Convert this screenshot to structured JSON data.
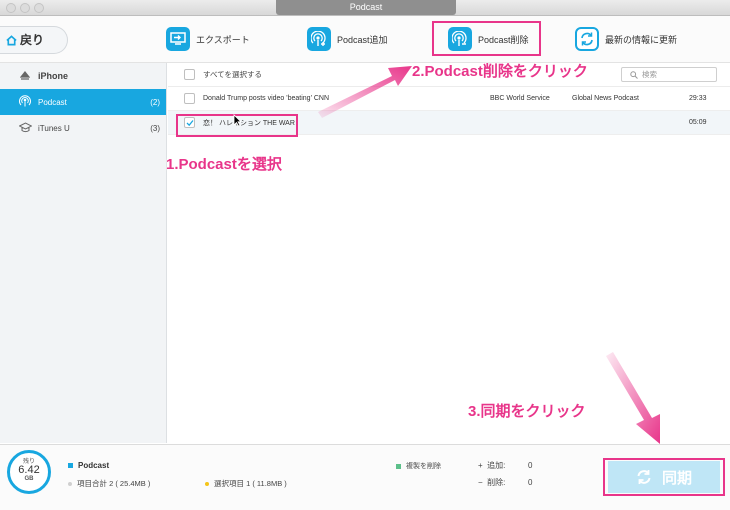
{
  "window": {
    "title": "Podcast"
  },
  "toolbar": {
    "back_label": "戻り",
    "export_label": "エクスポート",
    "add_label": "Podcast追加",
    "delete_label": "Podcast削除",
    "refresh_label": "最新の情報に更新"
  },
  "sidebar": {
    "device": "iPhone",
    "items": [
      {
        "label": "Podcast",
        "count": "(2)"
      },
      {
        "label": "iTunes U",
        "count": "(3)"
      }
    ]
  },
  "list": {
    "select_all": "すべてを選択する",
    "search_placeholder": "検索",
    "rows": [
      {
        "title": "Donald Trump posts video 'beating' CNN",
        "artist": "BBC World Service",
        "album": "Global News Podcast",
        "time": "29:33",
        "checked": false
      },
      {
        "title": "恋！ ハレイション THE WAR",
        "artist": "",
        "album": "",
        "time": "05:09",
        "checked": true
      }
    ]
  },
  "storage": {
    "remaining_label": "残り",
    "value": "6.42",
    "unit": "GB"
  },
  "footer": {
    "section": "Podcast",
    "total": "項目合計 2 ( 25.4MB )",
    "selected": "選択項目 1 ( 11.8MB )",
    "dup_delete": "複製を削除",
    "add_label": "追加:",
    "add_value": "0",
    "delete_label": "削除:",
    "delete_value": "0",
    "sync_label": "同期"
  },
  "annotations": {
    "step1": "1.Podcastを選択",
    "step2": "2.Podcast削除をクリック",
    "step3": "3.同期をクリック"
  },
  "colors": {
    "accent": "#18a7e0",
    "annotation": "#e8358a"
  }
}
